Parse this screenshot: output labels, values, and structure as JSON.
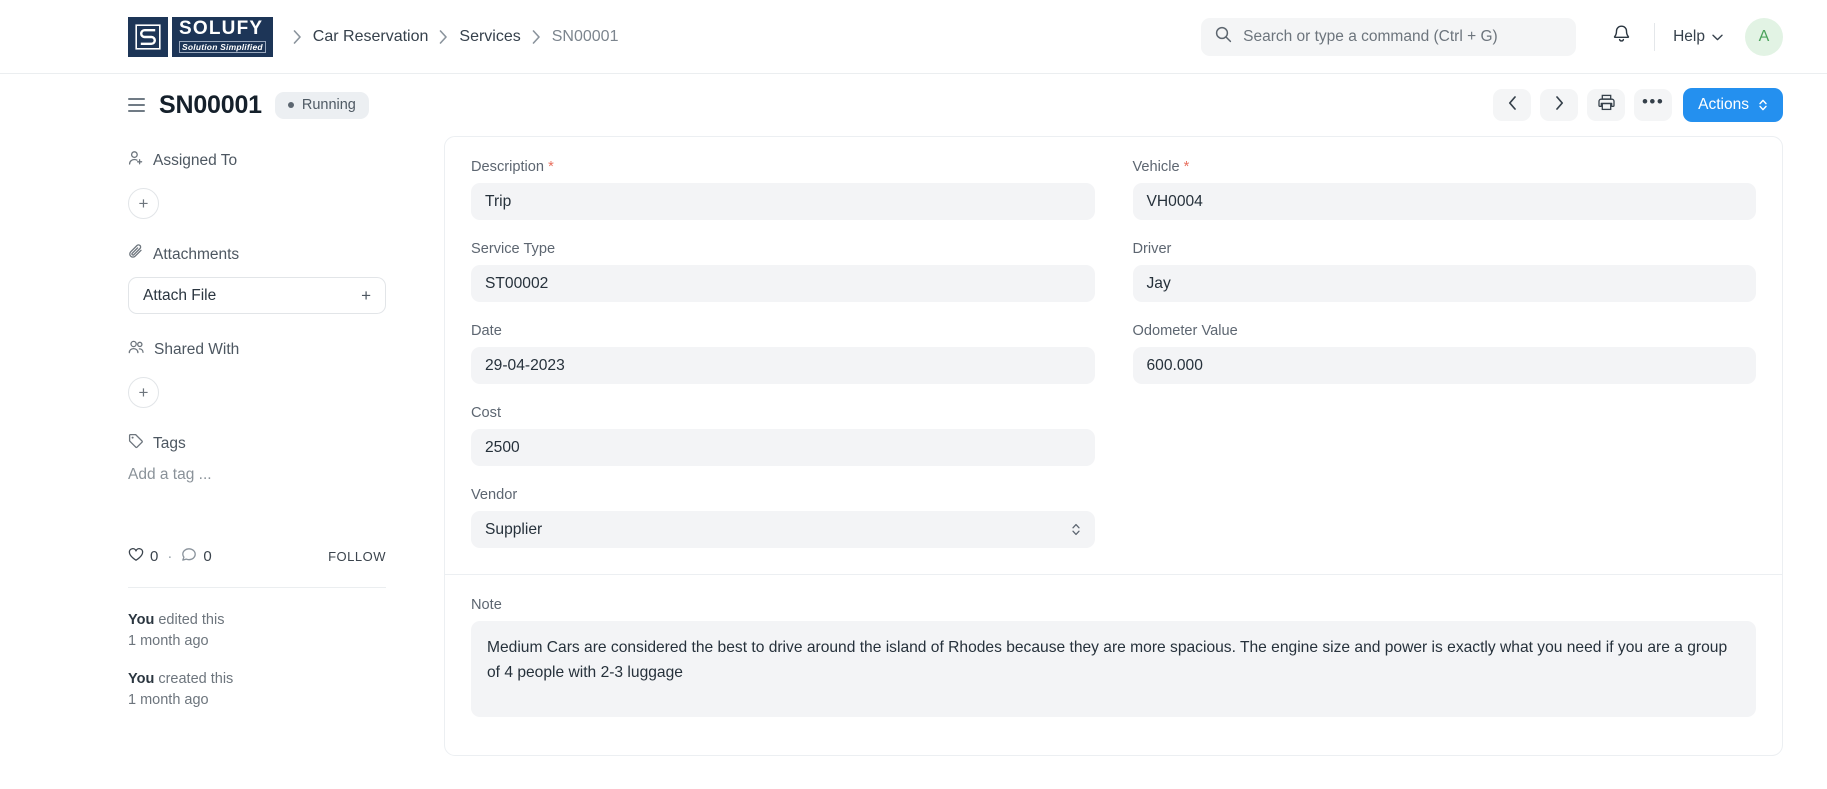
{
  "navbar": {
    "logo": {
      "mark_letter": "S",
      "word": "SOLUFY",
      "tagline": "Solution Simplified"
    },
    "breadcrumb": [
      "Car Reservation",
      "Services",
      "SN00001"
    ],
    "search": {
      "placeholder": "Search or type a command (Ctrl + G)",
      "value": ""
    },
    "help_label": "Help",
    "avatar_initial": "A"
  },
  "title_row": {
    "title": "SN00001",
    "status": "Running",
    "actions_label": "Actions"
  },
  "sidebar": {
    "assigned_to_label": "Assigned To",
    "attachments_label": "Attachments",
    "attach_file_label": "Attach File",
    "shared_with_label": "Shared With",
    "tags_label": "Tags",
    "tag_placeholder": "Add a tag ...",
    "likes_count": "0",
    "comments_count": "0",
    "follow_label": "FOLLOW",
    "activity": [
      {
        "who": "You",
        "action": " edited this",
        "time": "1 month ago"
      },
      {
        "who": "You",
        "action": " created this",
        "time": "1 month ago"
      }
    ]
  },
  "form": {
    "left": [
      {
        "label": "Description",
        "required": true,
        "value": "Trip",
        "type": "text"
      },
      {
        "label": "Service Type",
        "required": false,
        "value": "ST00002",
        "type": "text"
      },
      {
        "label": "Date",
        "required": false,
        "value": "29-04-2023",
        "type": "text"
      },
      {
        "label": "Cost",
        "required": false,
        "value": "2500",
        "type": "text"
      },
      {
        "label": "Vendor",
        "required": false,
        "value": "Supplier",
        "type": "select"
      }
    ],
    "right": [
      {
        "label": "Vehicle",
        "required": true,
        "value": "VH0004",
        "type": "text"
      },
      {
        "label": "Driver",
        "required": false,
        "value": "Jay",
        "type": "text"
      },
      {
        "label": "Odometer Value",
        "required": false,
        "value": "600.000",
        "type": "text"
      }
    ],
    "note": {
      "label": "Note",
      "value": "Medium Cars are considered the best to drive around the island of Rhodes because they are more spacious. The engine size and power is exactly what you need if you are a group of 4 people with 2-3 luggage"
    }
  },
  "colors": {
    "accent": "#2490ef",
    "brand_navy": "#1d3557",
    "required_red": "#e8705f",
    "avatar_bg": "#e2f3e4",
    "avatar_fg": "#4aa25a",
    "field_bg": "#f3f4f6"
  }
}
